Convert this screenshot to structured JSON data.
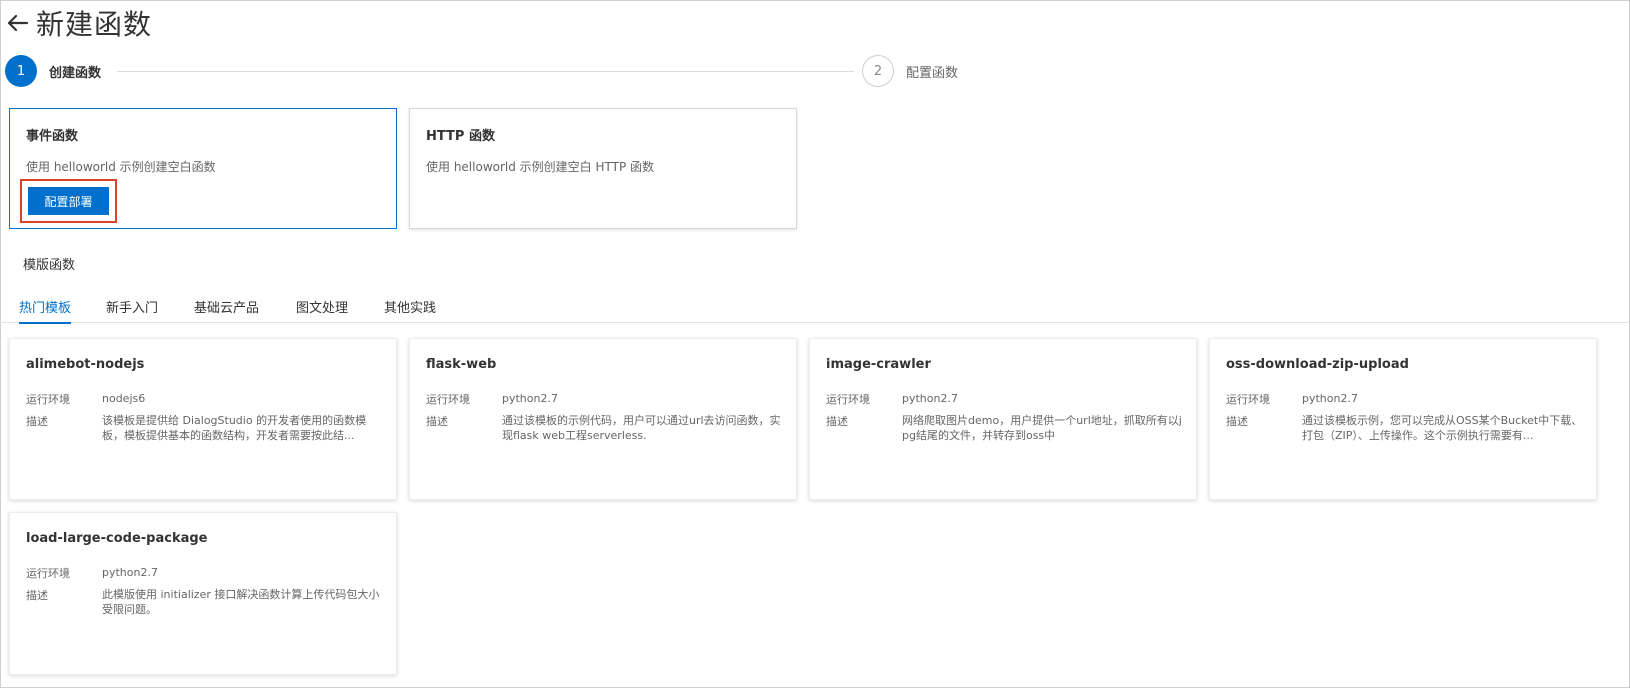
{
  "header": {
    "title": "新建函数"
  },
  "steps": [
    {
      "number": "1",
      "label": "创建函数"
    },
    {
      "number": "2",
      "label": "配置函数"
    }
  ],
  "create_options": [
    {
      "title": "事件函数",
      "description": "使用 helloworld 示例创建空白函数",
      "button_label": "配置部署"
    },
    {
      "title": "HTTP 函数",
      "description": "使用 helloworld 示例创建空白 HTTP 函数"
    }
  ],
  "templates_section": {
    "title": "模版函数",
    "tabs": [
      "热门模板",
      "新手入门",
      "基础云产品",
      "图文处理",
      "其他实践"
    ],
    "env_label": "运行环境",
    "desc_label": "描述",
    "cards": [
      {
        "name": "alimebot-nodejs",
        "runtime": "nodejs6",
        "description": "该模板是提供给 DialogStudio 的开发者使用的函数模板，模板提供基本的函数结构，开发者需要按此结..."
      },
      {
        "name": "flask-web",
        "runtime": "python2.7",
        "description": "通过该模板的示例代码，用户可以通过url去访问函数，实现flask web工程serverless."
      },
      {
        "name": "image-crawler",
        "runtime": "python2.7",
        "description": "网络爬取图片demo，用户提供一个url地址，抓取所有以jpg结尾的文件，并转存到oss中"
      },
      {
        "name": "oss-download-zip-upload",
        "runtime": "python2.7",
        "description": "通过该模板示例，您可以完成从OSS某个Bucket中下载、打包（ZIP）、上传操作。这个示例执行需要有..."
      },
      {
        "name": "load-large-code-package",
        "runtime": "python2.7",
        "description": "此模版使用 initializer 接口解决函数计算上传代码包大小受限问题。"
      }
    ]
  },
  "colors": {
    "accent": "#0070cc",
    "highlight": "#e0412a"
  }
}
